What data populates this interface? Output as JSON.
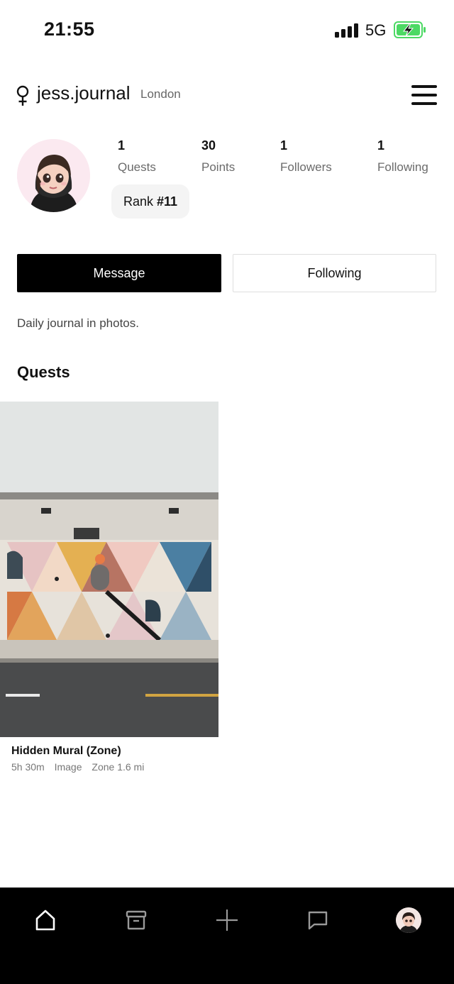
{
  "status_bar": {
    "time": "21:55",
    "network": "5G",
    "icons": [
      "signal-icon",
      "battery-charging-icon"
    ],
    "battery_color": "#4cd964"
  },
  "header": {
    "username": "jess.journal",
    "location": "London",
    "icons": [
      "female-gender-icon",
      "hamburger-menu-icon"
    ]
  },
  "profile": {
    "stats": [
      {
        "value": "1",
        "label": "Quests"
      },
      {
        "value": "30",
        "label": "Points"
      },
      {
        "value": "1",
        "label": "Followers"
      },
      {
        "value": "1",
        "label": "Following"
      }
    ],
    "rank_prefix": "Rank ",
    "rank_value": "#11",
    "message_button": "Message",
    "following_button": "Following",
    "bio": "Daily journal in photos."
  },
  "quests": {
    "title": "Quests",
    "items": [
      {
        "title": "Hidden Mural (Zone)",
        "duration": "5h 30m",
        "type": "Image",
        "zone": "Zone 1.6 mi"
      }
    ]
  },
  "bottom_nav": {
    "items": [
      "home-icon",
      "archive-icon",
      "plus-icon",
      "chat-icon",
      "profile-avatar"
    ]
  }
}
